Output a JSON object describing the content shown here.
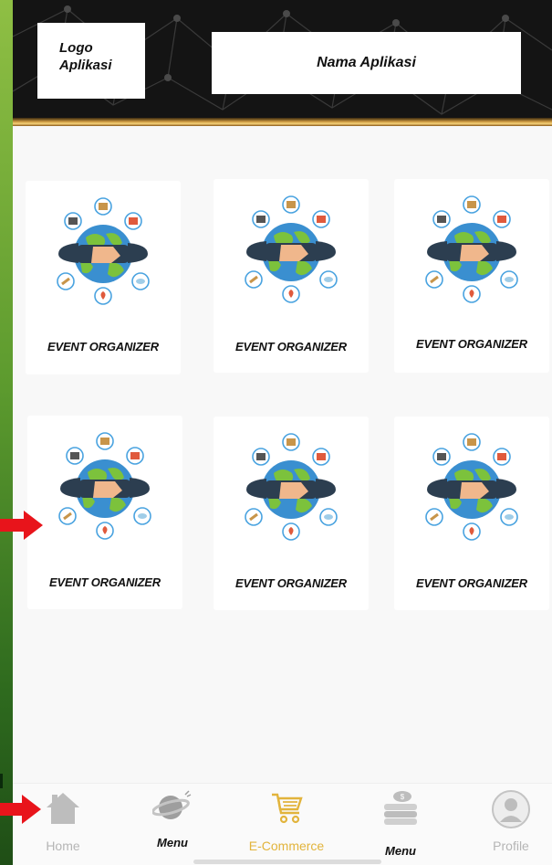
{
  "header": {
    "logo_line1": "Logo",
    "logo_line2": "Aplikasi",
    "app_name": "Nama Aplikasi"
  },
  "cards": [
    {
      "label": "EVENT ORGANIZER"
    },
    {
      "label": "EVENT ORGANIZER"
    },
    {
      "label": "EVENT ORGANIZER"
    },
    {
      "label": "EVENT ORGANIZER"
    },
    {
      "label": "EVENT ORGANIZER"
    },
    {
      "label": "EVENT ORGANIZER"
    }
  ],
  "nav": {
    "items": [
      {
        "label": "Home",
        "icon": "home-icon"
      },
      {
        "label": "Menu",
        "icon": "planet-icon"
      },
      {
        "label": "E-Commerce",
        "icon": "cart-icon"
      },
      {
        "label": "Menu",
        "icon": "coins-icon"
      },
      {
        "label": "Profile",
        "icon": "profile-icon"
      }
    ]
  },
  "colors": {
    "header_bg": "#141414",
    "gold_accent": "#d9a84a",
    "active_nav": "#e2b43c",
    "inactive_nav": "#b5b5b5",
    "annotation_arrow": "#e8141b",
    "side_panel_green": "#5c9a2e"
  }
}
